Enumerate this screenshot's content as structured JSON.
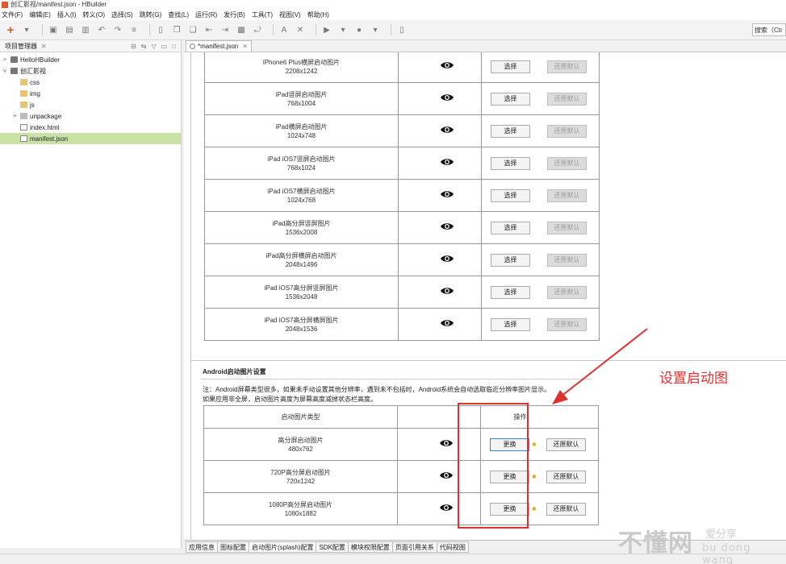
{
  "window": {
    "title": "创汇影视/manifest.json - HBuilder"
  },
  "menu": [
    "文件(F)",
    "编辑(E)",
    "插入(I)",
    "转义(O)",
    "选择(S)",
    "跳转(G)",
    "查找(L)",
    "运行(R)",
    "发行(B)",
    "工具(T)",
    "视图(V)",
    "帮助(H)"
  ],
  "toolbar": {
    "search_placeholder": "搜索（Ctr"
  },
  "project_panel": {
    "title": "项目管理器",
    "tree": [
      {
        "label": "HelloHBuilder",
        "icon": "project-icon",
        "level": 0,
        "arrow": ">"
      },
      {
        "label": "创汇影视",
        "icon": "project-icon",
        "level": 0,
        "arrow": "v"
      },
      {
        "label": "css",
        "icon": "folder-icon",
        "level": 1,
        "arrow": ""
      },
      {
        "label": "img",
        "icon": "folder-icon",
        "level": 1,
        "arrow": ""
      },
      {
        "label": "js",
        "icon": "folder-icon",
        "level": 1,
        "arrow": ""
      },
      {
        "label": "unpackage",
        "icon": "package-icon",
        "level": 1,
        "arrow": ">"
      },
      {
        "label": "index.html",
        "icon": "file-icon",
        "level": 1,
        "arrow": ""
      },
      {
        "label": "manifest.json",
        "icon": "file-icon",
        "level": 1,
        "arrow": "",
        "selected": true
      }
    ]
  },
  "editor": {
    "tab_label": "*manifest.json"
  },
  "ios_rows": [
    {
      "name": "iPhone6 Plus横屏启动图片",
      "size": "2208x1242"
    },
    {
      "name": "iPad竖屏启动图片",
      "size": "768x1004"
    },
    {
      "name": "iPad横屏启动图片",
      "size": "1024x748"
    },
    {
      "name": "iPad iOS7竖屏启动图片",
      "size": "768x1024"
    },
    {
      "name": "iPad iOS7横屏启动图片",
      "size": "1024x768"
    },
    {
      "name": "iPad高分屏竖屏图片",
      "size": "1536x2008"
    },
    {
      "name": "iPad高分屏横屏启动图片",
      "size": "2048x1496"
    },
    {
      "name": "iPad iOS7高分屏竖屏图片",
      "size": "1536x2048"
    },
    {
      "name": "iPad iOS7高分屏横屏图片",
      "size": "2048x1536"
    }
  ],
  "ios_buttons": {
    "select": "选择",
    "restore": "还原默认"
  },
  "android": {
    "title": "Android启动图片设置",
    "note_line1": "注：Android屏幕类型很多，如果未手动设置其他分辨率，遇到未不包括时，Android系统会自动选取临近分辨率图片显示。",
    "note_line2": "如果应用非全屏，启动图片高度为屏幕高度减掉状态栏高度。",
    "col_type": "启动图片类型",
    "col_action": "操作",
    "replace": "更换",
    "restore": "还原默认",
    "rows": [
      {
        "name": "高分屏启动图片",
        "size": "480x762"
      },
      {
        "name": "720P高分屏启动图片",
        "size": "720x1242"
      },
      {
        "name": "1080P高分屏启动图片",
        "size": "1080x1882"
      }
    ]
  },
  "bottom_tabs": [
    "应用信息",
    "图标配置",
    "启动图片(splash)配置",
    "SDK配置",
    "模块权限配置",
    "页面引用关系",
    "代码视图"
  ],
  "annotation": {
    "text": "设置启动图",
    "color": "#e03030"
  },
  "watermark": {
    "main": "不懂网",
    "sub": "爱分享",
    "pinyin": "bu dong wang"
  }
}
